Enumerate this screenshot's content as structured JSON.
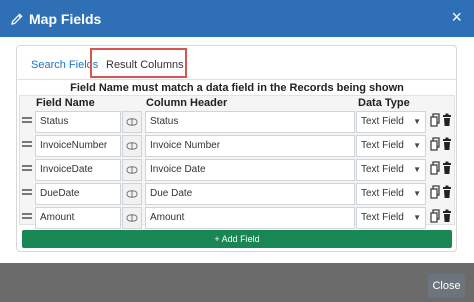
{
  "dialog": {
    "title": "Map Fields",
    "close_glyph": "×",
    "title_icon": "pencil-icon"
  },
  "tabs": [
    {
      "label": "Search Fields",
      "active": false
    },
    {
      "label": "Result Columns",
      "active": true
    }
  ],
  "notice": "Field Name must match a data field in the Records being shown",
  "columns": {
    "field_name": "Field Name",
    "column_header": "Column Header",
    "data_type": "Data Type"
  },
  "rows": [
    {
      "field": "Status",
      "header": "Status",
      "type": "Text Field"
    },
    {
      "field": "InvoiceNumber",
      "header": "Invoice Number",
      "type": "Text Field"
    },
    {
      "field": "InvoiceDate",
      "header": "Invoice Date",
      "type": "Text Field"
    },
    {
      "field": "DueDate",
      "header": "Due Date",
      "type": "Text Field"
    },
    {
      "field": "Amount",
      "header": "Amount",
      "type": "Text Field"
    }
  ],
  "add_button": "+ Add Field",
  "footer": {
    "close_label": "Close"
  },
  "colors": {
    "header": "#2f6fb5",
    "add_button": "#198754",
    "highlight": "#d9534f",
    "close_button": "#6c757d"
  }
}
